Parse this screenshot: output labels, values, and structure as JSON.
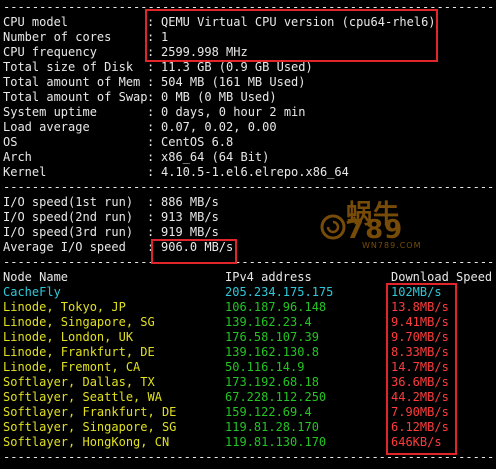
{
  "separator": "----------------------------------------------------------------------",
  "system": {
    "cpu_model": {
      "key": "CPU model",
      "value": "QEMU Virtual CPU version (cpu64-rhel6)"
    },
    "cores": {
      "key": "Number of cores",
      "value": "1"
    },
    "freq": {
      "key": "CPU frequency",
      "value": "2599.998 MHz"
    },
    "disk": {
      "key": "Total size of Disk",
      "value": "11.3 GB (0.9 GB Used)"
    },
    "mem": {
      "key": "Total amount of Mem",
      "value": "504 MB (161 MB Used)"
    },
    "swap": {
      "key": "Total amount of Swap",
      "value": "0 MB (0 MB Used)"
    },
    "uptime": {
      "key": "System uptime",
      "value": "0 days, 0 hour 2 min"
    },
    "load": {
      "key": "Load average",
      "value": "0.07, 0.02, 0.00"
    },
    "os": {
      "key": "OS",
      "value": "CentOS 6.8"
    },
    "arch": {
      "key": "Arch",
      "value": "x86_64 (64 Bit)"
    },
    "kernel": {
      "key": "Kernel",
      "value": "4.10.5-1.el6.elrepo.x86_64"
    }
  },
  "io": {
    "run1": {
      "key": "I/O speed(1st run)",
      "value": "886 MB/s"
    },
    "run2": {
      "key": "I/O speed(2nd run)",
      "value": "913 MB/s"
    },
    "run3": {
      "key": "I/O speed(3rd run)",
      "value": "919 MB/s"
    },
    "avg": {
      "key": "Average I/O speed",
      "value": "906.0 MB/s"
    }
  },
  "colon": ":",
  "network": {
    "headers": {
      "name": "Node Name",
      "ip": "IPv4 address",
      "speed": "Download Speed"
    },
    "rows": [
      {
        "name": "CacheFly",
        "ip": "205.234.175.175",
        "speed": "102MB/s"
      },
      {
        "name": "Linode, Tokyo, JP",
        "ip": "106.187.96.148",
        "speed": "13.8MB/s"
      },
      {
        "name": "Linode, Singapore, SG",
        "ip": "139.162.23.4",
        "speed": "9.41MB/s"
      },
      {
        "name": "Linode, London, UK",
        "ip": "176.58.107.39",
        "speed": "9.70MB/s"
      },
      {
        "name": "Linode, Frankfurt, DE",
        "ip": "139.162.130.8",
        "speed": "8.33MB/s"
      },
      {
        "name": "Linode, Fremont, CA",
        "ip": "50.116.14.9",
        "speed": "14.7MB/s"
      },
      {
        "name": "Softlayer, Dallas, TX",
        "ip": "173.192.68.18",
        "speed": "36.6MB/s"
      },
      {
        "name": "Softlayer, Seattle, WA",
        "ip": "67.228.112.250",
        "speed": "44.2MB/s"
      },
      {
        "name": "Softlayer, Frankfurt, DE",
        "ip": "159.122.69.4",
        "speed": "7.90MB/s"
      },
      {
        "name": "Softlayer, Singapore, SG",
        "ip": "119.81.28.170",
        "speed": "6.12MB/s"
      },
      {
        "name": "Softlayer, HongKong, CN",
        "ip": "119.81.130.170",
        "speed": "646KB/s"
      }
    ]
  },
  "watermark": {
    "main": "蜗牛789",
    "sub": "WN789.COM"
  },
  "colors": {
    "background": "#000000",
    "text": "#e8e8e8",
    "node_name": "#e0e020",
    "ip": "#23c423",
    "speed": "#ff3c3c",
    "cachefly": "#30c8d8",
    "highlight_box": "#e0262b",
    "watermark": "#d98a12"
  }
}
